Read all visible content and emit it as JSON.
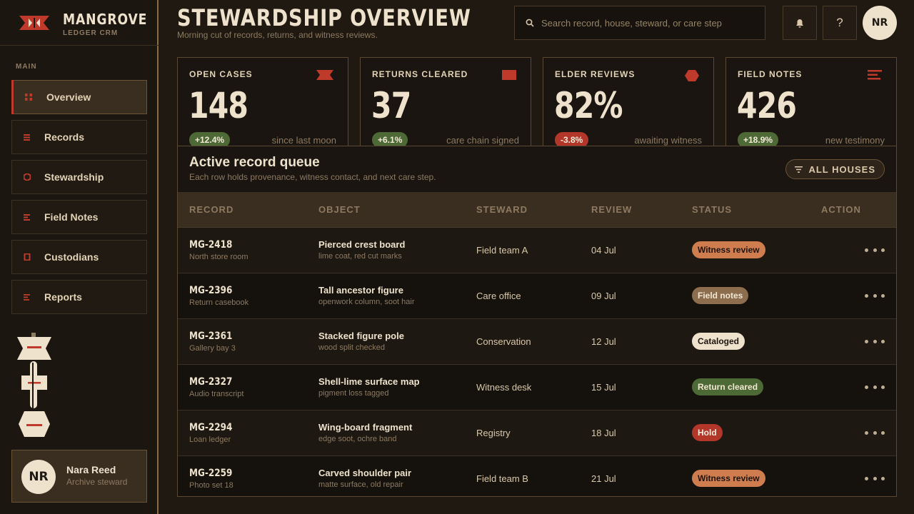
{
  "brand": {
    "name": "MANGROVE",
    "sub": "LEDGER CRM"
  },
  "sidebar": {
    "section": "MAIN",
    "items": [
      {
        "label": "Overview",
        "icon": "overview-icon",
        "active": true
      },
      {
        "label": "Records",
        "icon": "records-icon",
        "active": false
      },
      {
        "label": "Stewardship",
        "icon": "stewardship-icon",
        "active": false
      },
      {
        "label": "Field Notes",
        "icon": "field-notes-icon",
        "active": false
      },
      {
        "label": "Custodians",
        "icon": "custodians-icon",
        "active": false
      },
      {
        "label": "Reports",
        "icon": "reports-icon",
        "active": false
      }
    ],
    "user": {
      "initials": "NR",
      "name": "Nara Reed",
      "role": "Archive steward"
    }
  },
  "header": {
    "title": "STEWARDSHIP OVERVIEW",
    "subtitle": "Morning cut of records, returns, and witness reviews.",
    "search_placeholder": "Search record, house, steward, or care step",
    "help": "?",
    "avatar_initials": "NR"
  },
  "stats": [
    {
      "label": "OPEN CASES",
      "value": "148",
      "delta": "+12.4%",
      "trend": "up",
      "note": "since last moon",
      "icon": "open-cases-icon"
    },
    {
      "label": "RETURNS CLEARED",
      "value": "37",
      "delta": "+6.1%",
      "trend": "up",
      "note": "care chain signed",
      "icon": "returns-icon"
    },
    {
      "label": "ELDER REVIEWS",
      "value": "82%",
      "delta": "-3.8%",
      "trend": "down",
      "note": "awaiting witness",
      "icon": "elder-reviews-icon"
    },
    {
      "label": "FIELD NOTES",
      "value": "426",
      "delta": "+18.9%",
      "trend": "up",
      "note": "new testimony",
      "icon": "field-notes-icon"
    }
  ],
  "queue": {
    "title": "Active record queue",
    "subtitle": "Each row holds provenance, witness contact, and next care step.",
    "filter_label": "ALL HOUSES",
    "columns": [
      "RECORD",
      "OBJECT",
      "STEWARD",
      "REVIEW",
      "STATUS",
      "ACTION"
    ],
    "rows": [
      {
        "id": "MG-2418",
        "location": "North store room",
        "object": "Pierced crest board",
        "detail": "lime coat, red cut marks",
        "steward": "Field team A",
        "review": "04 Jul",
        "status": "Witness review"
      },
      {
        "id": "MG-2396",
        "location": "Return casebook",
        "object": "Tall ancestor figure",
        "detail": "openwork column, soot hair",
        "steward": "Care office",
        "review": "09 Jul",
        "status": "Field notes"
      },
      {
        "id": "MG-2361",
        "location": "Gallery bay 3",
        "object": "Stacked figure pole",
        "detail": "wood split checked",
        "steward": "Conservation",
        "review": "12 Jul",
        "status": "Cataloged"
      },
      {
        "id": "MG-2327",
        "location": "Audio transcript",
        "object": "Shell-lime surface map",
        "detail": "pigment loss tagged",
        "steward": "Witness desk",
        "review": "15 Jul",
        "status": "Return cleared"
      },
      {
        "id": "MG-2294",
        "location": "Loan ledger",
        "object": "Wing-board fragment",
        "detail": "edge soot, ochre band",
        "steward": "Registry",
        "review": "18 Jul",
        "status": "Hold"
      },
      {
        "id": "MG-2259",
        "location": "Photo set 18",
        "object": "Carved shoulder pair",
        "detail": "matte surface, old repair",
        "steward": "Field team B",
        "review": "21 Jul",
        "status": "Witness review"
      }
    ]
  },
  "colors": {
    "accent_red": "#c03a2b",
    "gold_border": "#8a6b43",
    "positive": "#4d6a36",
    "negative": "#b3362a",
    "status": {
      "Witness review": {
        "bg": "#cf7d4f",
        "fg": "#1d150e"
      },
      "Field notes": {
        "bg": "#8c6d4e",
        "fg": "#f1e6d2"
      },
      "Cataloged": {
        "bg": "#efe2cc",
        "fg": "#1d150e"
      },
      "Return cleared": {
        "bg": "#4d6a36",
        "fg": "#f1e6d2"
      },
      "Hold": {
        "bg": "#b3362a",
        "fg": "#f5ecde"
      }
    }
  }
}
